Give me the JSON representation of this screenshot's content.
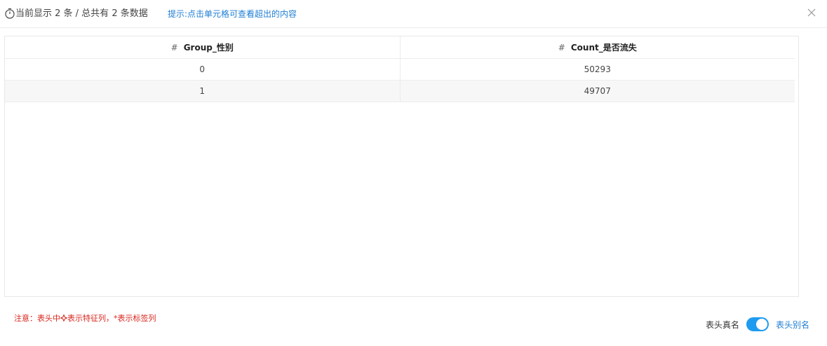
{
  "header": {
    "info": "当前显示 2 条 / 总共有 2 条数据",
    "tip": "提示:点击单元格可查看超出的内容"
  },
  "table": {
    "columns": [
      {
        "symbol": "#",
        "label": "Group_性别"
      },
      {
        "symbol": "#",
        "label": "Count_是否流失"
      }
    ],
    "rows": [
      [
        "0",
        "50293"
      ],
      [
        "1",
        "49707"
      ]
    ]
  },
  "footer": {
    "note_prefix": "注意：表头中",
    "note_suffix": "表示特征列，*表示标签列",
    "toggle_left": "表头真名",
    "toggle_right": "表头别名",
    "toggle_on": true
  },
  "colors": {
    "accent": "#1f9bf0",
    "link": "#1f7ed4",
    "warning": "#d9251c"
  },
  "icons": [
    "timer-icon",
    "close-icon",
    "feature-column-icon"
  ]
}
